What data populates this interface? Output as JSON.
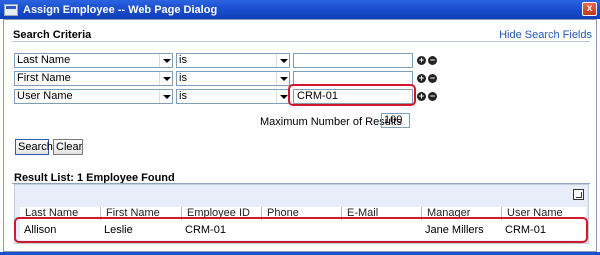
{
  "window": {
    "title": "Assign Employee -- Web Page Dialog",
    "close_glyph": "x"
  },
  "search": {
    "title": "Search Criteria",
    "hide_link": "Hide Search Fields",
    "rows": [
      {
        "field": "Last Name",
        "operator": "is",
        "value": ""
      },
      {
        "field": "First Name",
        "operator": "is",
        "value": ""
      },
      {
        "field": "User Name",
        "operator": "is",
        "value": "CRM-01"
      }
    ],
    "add_glyph": "+",
    "remove_glyph": "−",
    "max_results_label": "Maximum Number of Results",
    "max_results_value": "100",
    "search_button": "Search",
    "clear_button": "Clear"
  },
  "results": {
    "title": "Result List: 1 Employee Found",
    "columns": [
      "Last Name",
      "First Name",
      "Employee ID",
      "Phone",
      "E-Mail",
      "Manager",
      "User Name"
    ],
    "rows": [
      [
        "Allison",
        "Leslie",
        "CRM-01",
        "",
        "",
        "Jane Millers",
        "CRM-01"
      ]
    ]
  },
  "colors": {
    "titlebar": "#1a4fcf",
    "link": "#2355b8",
    "highlight": "#d2182b",
    "grid_bg": "#e8eef9"
  }
}
